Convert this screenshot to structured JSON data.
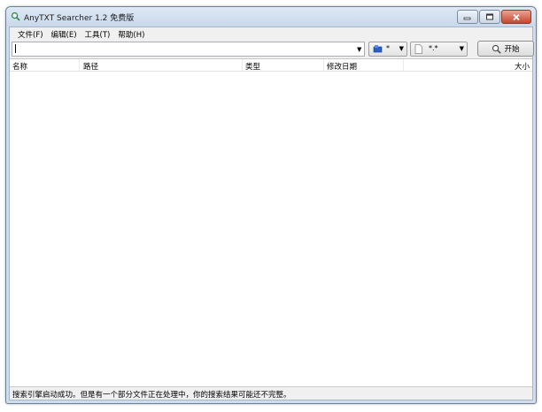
{
  "window": {
    "title": "AnyTXT Searcher 1.2 免费版"
  },
  "menu": [
    {
      "label": "文件(F)"
    },
    {
      "label": "编辑(E)"
    },
    {
      "label": "工具(T)"
    },
    {
      "label": "帮助(H)"
    }
  ],
  "toolbar": {
    "search_value": "",
    "location_filter": "*",
    "filetype_filter": "*.*",
    "start_label": "开始"
  },
  "columns": [
    "名称",
    "路径",
    "类型",
    "修改日期",
    "大小"
  ],
  "status": "搜索引擎启动成功。但是有一个部分文件正在处理中，你的搜索结果可能还不完整。",
  "icons": {
    "app": "magnifier-icon",
    "minimize": "minimize-icon",
    "maximize": "maximize-icon",
    "close": "close-icon",
    "search": "magnifier-icon",
    "location": "drive-icon",
    "filetype": "file-icon"
  }
}
